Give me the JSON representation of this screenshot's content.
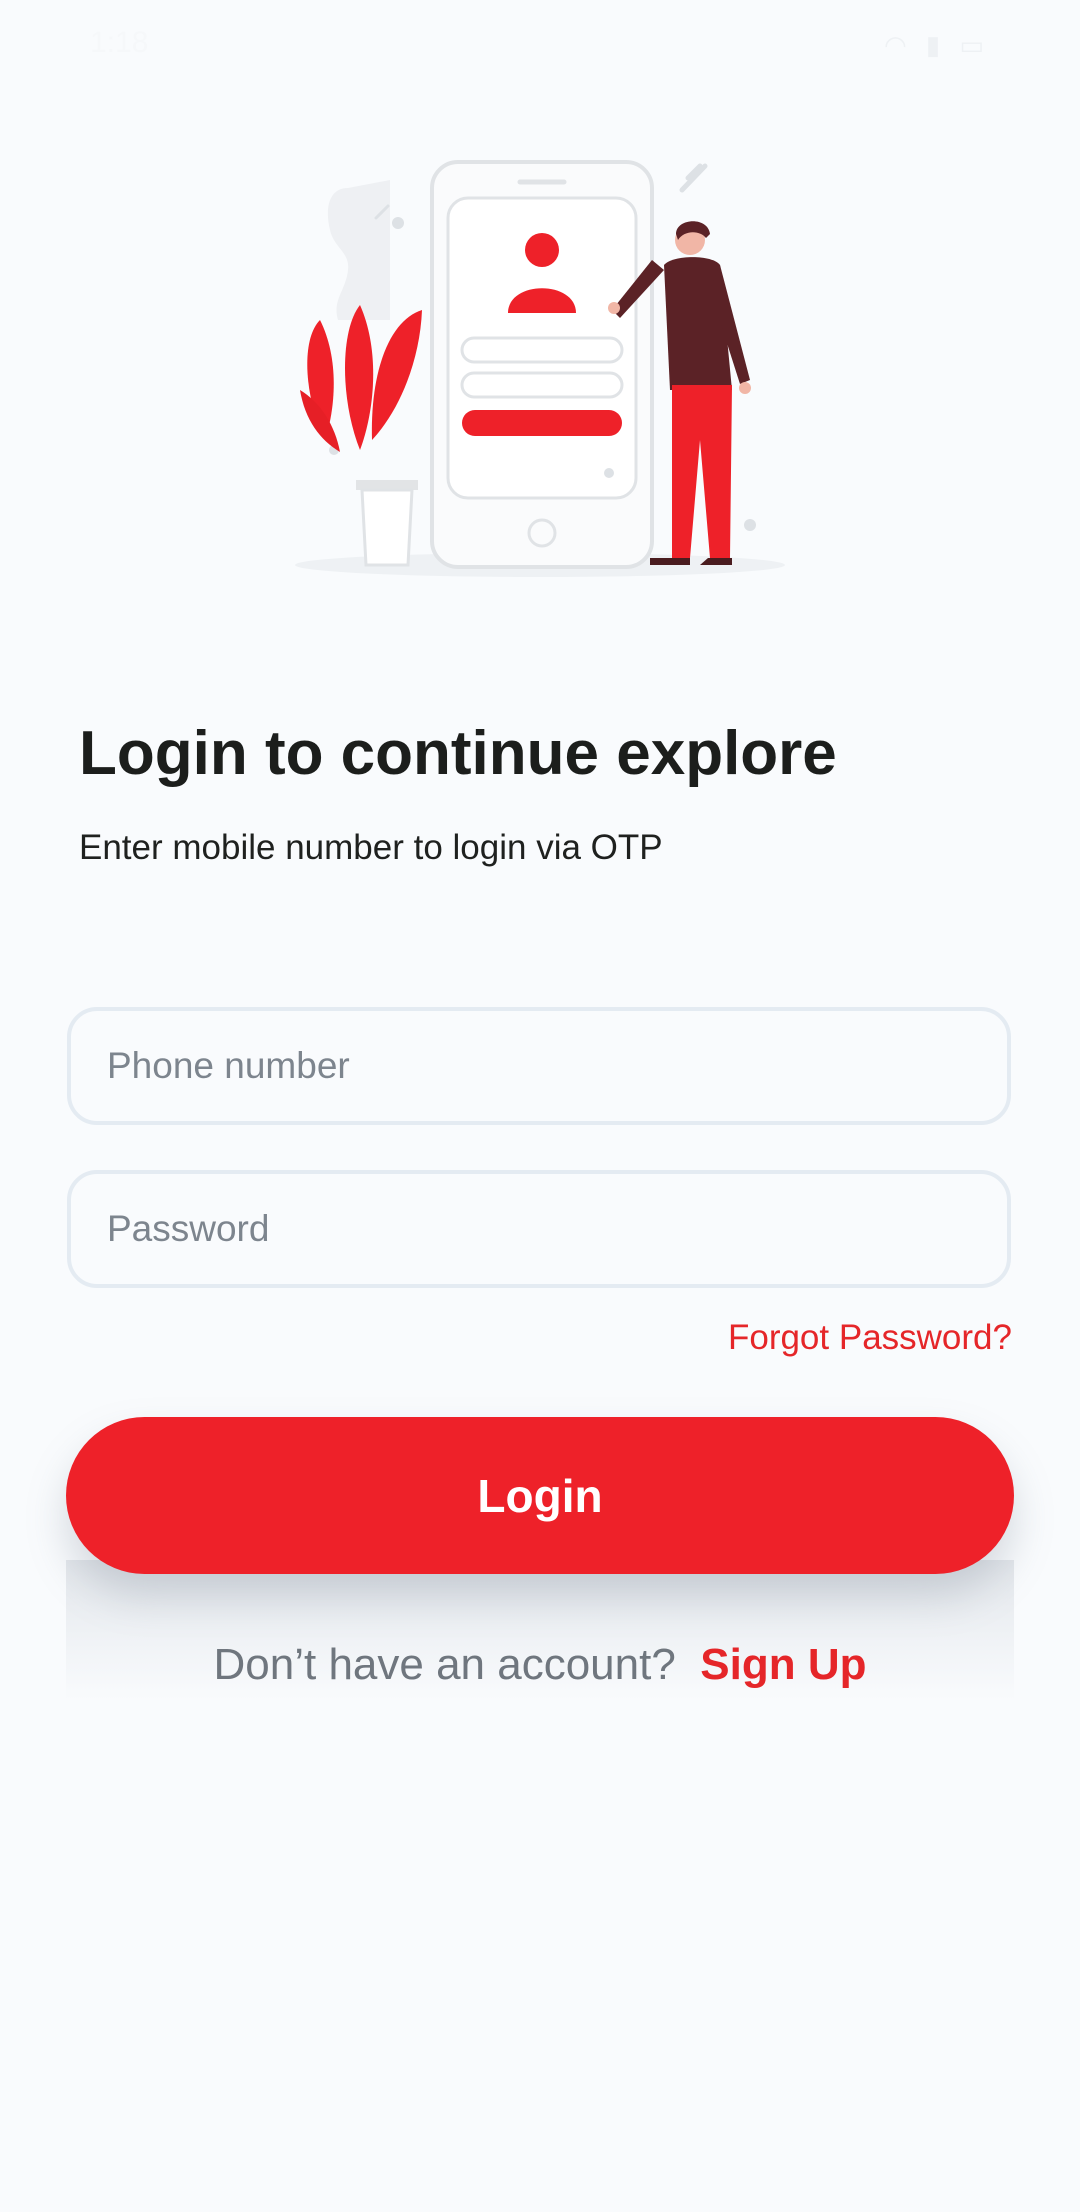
{
  "status_bar": {
    "time": "1:18",
    "icons": [
      "wifi-icon",
      "signal-icon",
      "battery-icon"
    ]
  },
  "login": {
    "title": "Login to continue explore",
    "subtitle": "Enter mobile number to login via OTP",
    "phone_placeholder": "Phone number",
    "password_placeholder": "Password",
    "forgot_password": "Forgot Password?",
    "login_button": "Login",
    "signup_prompt": "Don’t have an account?",
    "signup_link": "Sign Up"
  },
  "colors": {
    "accent": "#ee2129",
    "background": "#f9fbfd",
    "title_text": "#1c1e1c",
    "muted_text": "#6f767e",
    "field_border": "#e4ebf2"
  }
}
